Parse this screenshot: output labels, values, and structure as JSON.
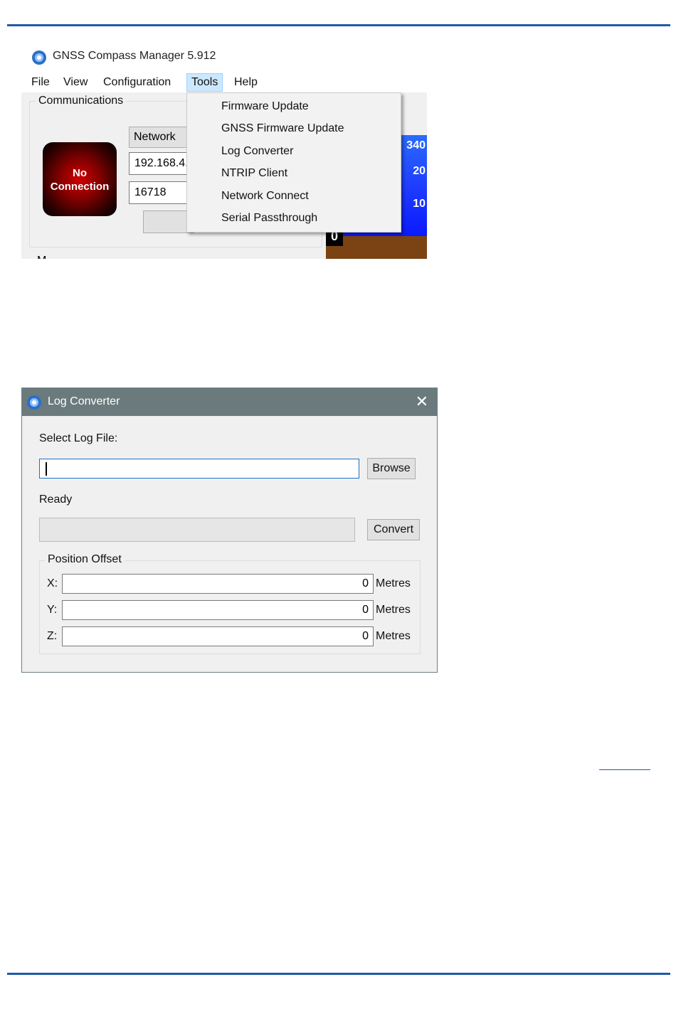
{
  "colors": {
    "rule": "#1f5aa6",
    "dialog_titlebar": "#6b7b7d",
    "menu_highlight": "#cce8ff"
  },
  "manager": {
    "title": "GNSS Compass Manager 5.912",
    "menu": [
      "File",
      "View",
      "Configuration",
      "Tools",
      "Help"
    ],
    "open_menu": "Tools",
    "communications_label": "Communications",
    "connection_status": {
      "line1": "No",
      "line2": "Connection"
    },
    "mode_select": "Network",
    "ip_field": "192.168.4.",
    "port_field": "16718",
    "gauge_ticks": [
      "340",
      "20",
      "10"
    ],
    "gauge_value": "0",
    "partial_label": "M",
    "tools_menu_items": [
      "Firmware Update",
      "GNSS Firmware Update",
      "Log Converter",
      "NTRIP Client",
      "Network Connect",
      "Serial Passthrough"
    ]
  },
  "log_converter": {
    "title": "Log Converter",
    "close_icon": "close-icon",
    "select_label": "Select Log File:",
    "file_value": "",
    "browse_label": "Browse",
    "status": "Ready",
    "progress": 0,
    "convert_label": "Convert",
    "offset_group": "Position Offset",
    "offsets": [
      {
        "axis": "X:",
        "value": "0",
        "unit": "Metres"
      },
      {
        "axis": "Y:",
        "value": "0",
        "unit": "Metres"
      },
      {
        "axis": "Z:",
        "value": "0",
        "unit": "Metres"
      }
    ]
  }
}
